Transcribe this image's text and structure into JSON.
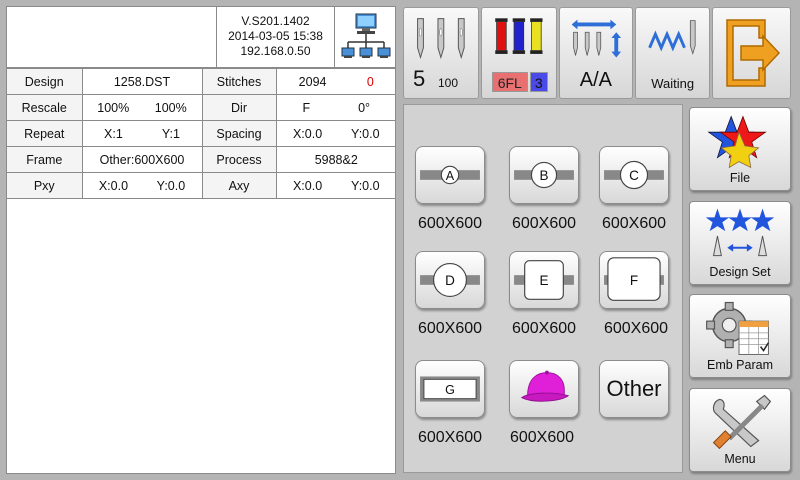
{
  "header": {
    "version": "V.S201.1402",
    "datetime": "2014-03-05 15:38",
    "ip": "192.168.0.50",
    "network_icon": "network-computer-icon"
  },
  "info": {
    "design_label": "Design",
    "design_value": "1258.DST",
    "stitches_label": "Stitches",
    "stitches_value": "2094",
    "stitches_current": "0",
    "rescale_label": "Rescale",
    "rescale_x": "100%",
    "rescale_y": "100%",
    "dir_label": "Dir",
    "dir_value": "F",
    "dir_angle": "0°",
    "repeat_label": "Repeat",
    "repeat_x": "X:1",
    "repeat_y": "Y:1",
    "spacing_label": "Spacing",
    "spacing_x": "X:0.0",
    "spacing_y": "Y:0.0",
    "frame_label": "Frame",
    "frame_value": "Other:600X600",
    "process_label": "Process",
    "process_value": "5988&2",
    "pxy_label": "Pxy",
    "pxy_x": "X:0.0",
    "pxy_y": "Y:0.0",
    "axy_label": "Axy",
    "axy_x": "X:0.0",
    "axy_y": "Y:0.0"
  },
  "status": {
    "needle_number": "5",
    "needle_speed": "100",
    "color_code": "6FL",
    "color_index": "3",
    "frame_mode": "A/A",
    "machine_state": "Waiting",
    "colors": {
      "spool_red": "#e01010",
      "spool_blue": "#2222cc",
      "spool_yellow": "#e8e020",
      "exit_orange": "#f0a020"
    }
  },
  "frames": [
    {
      "letter": "A",
      "size": "600X600"
    },
    {
      "letter": "B",
      "size": "600X600"
    },
    {
      "letter": "C",
      "size": "600X600"
    },
    {
      "letter": "D",
      "size": "600X600"
    },
    {
      "letter": "E",
      "size": "600X600"
    },
    {
      "letter": "F",
      "size": "600X600"
    },
    {
      "letter": "G",
      "size": "600X600"
    },
    {
      "letter": "",
      "size": "600X600",
      "icon": "cap-icon"
    },
    {
      "letter": "Other",
      "size": ""
    }
  ],
  "menu": {
    "file_label": "File",
    "design_set_label": "Design Set",
    "emb_param_label": "Emb Param",
    "menu_label": "Menu"
  }
}
